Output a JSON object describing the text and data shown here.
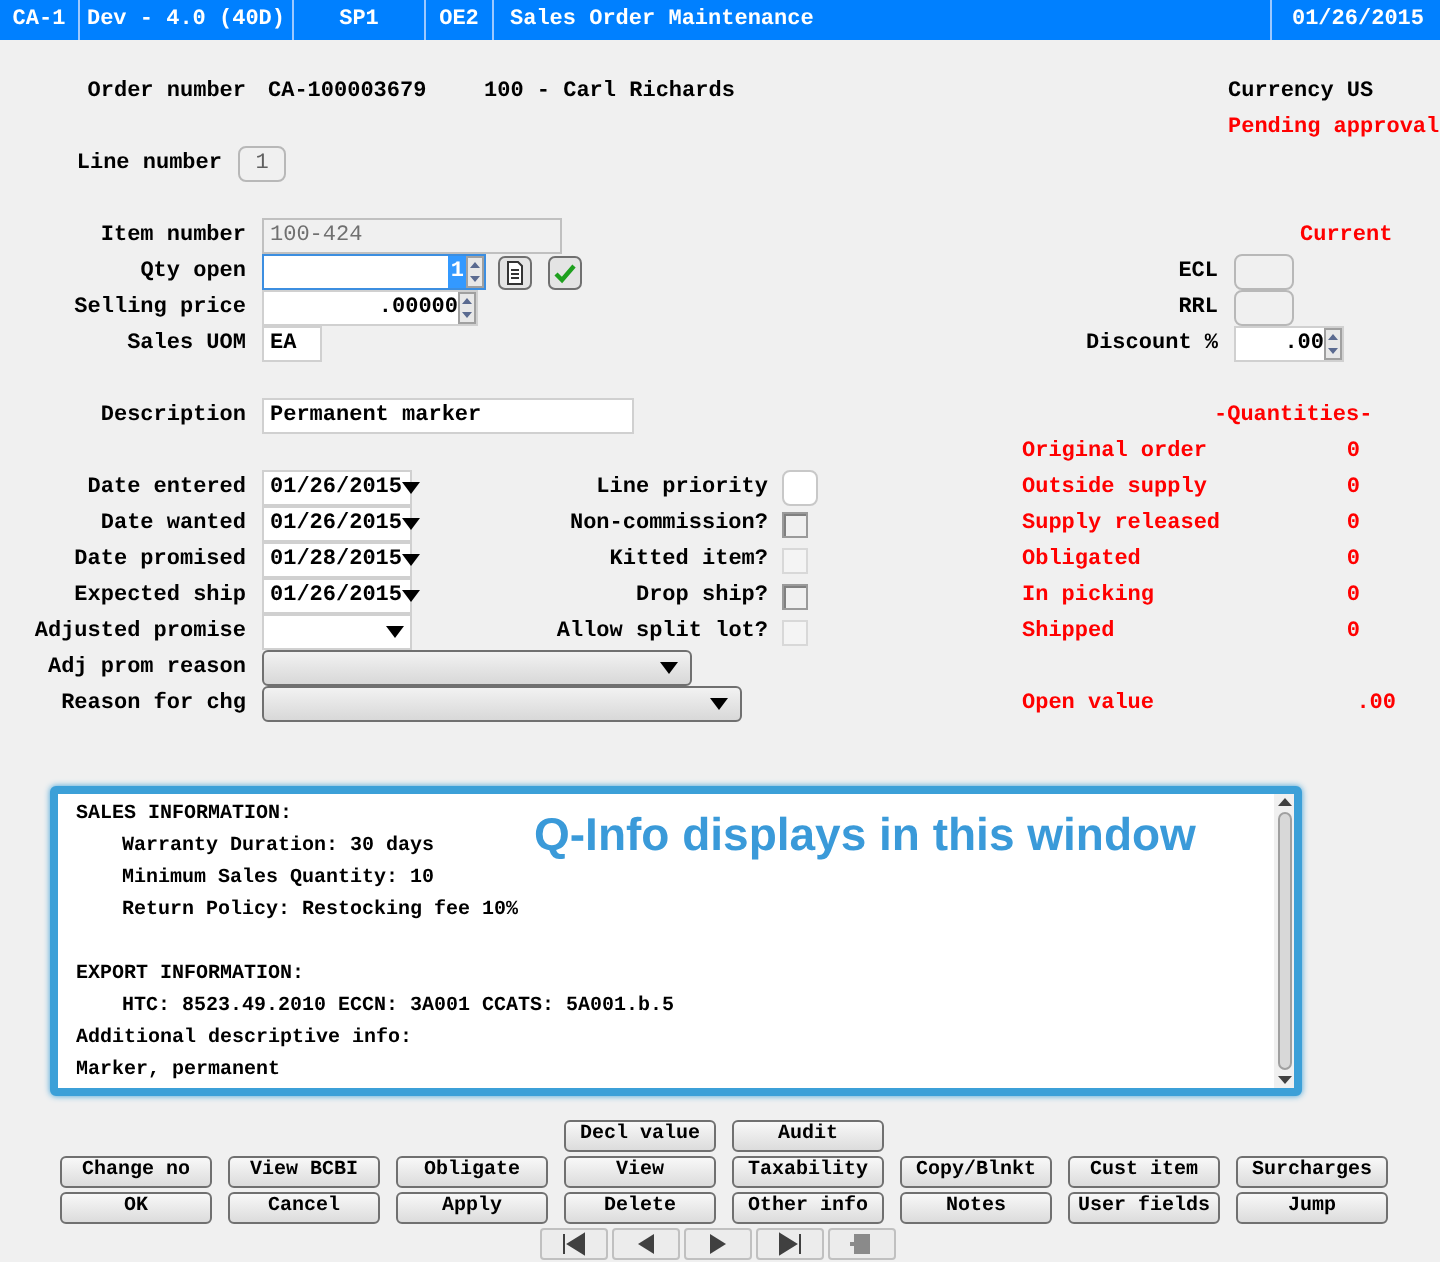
{
  "title_bar": {
    "segments": [
      "CA-1",
      "Dev - 4.0 (40D)",
      "SP1",
      "OE2",
      "Sales Order Maintenance",
      "01/26/2015"
    ]
  },
  "header": {
    "order_label": "Order number",
    "order_number": "CA-100003679",
    "customer": "100 - Carl Richards",
    "currency": "Currency US",
    "status": "Pending approval"
  },
  "line_number": {
    "label": "Line number",
    "value": "1"
  },
  "item_number": {
    "label": "Item number",
    "value": "100-424",
    "disabled": true
  },
  "item_status": "Current",
  "qty_open": {
    "label": "Qty open",
    "value": "1"
  },
  "selling_price": {
    "label": "Selling price",
    "value": ".00000"
  },
  "sales_uom": {
    "label": "Sales UOM",
    "value": "EA"
  },
  "ecl": {
    "label": "ECL"
  },
  "rrl": {
    "label": "RRL"
  },
  "discount": {
    "label": "Discount %",
    "value": ".00"
  },
  "description": {
    "label": "Description",
    "value": "Permanent marker"
  },
  "quantities_title": "-Quantities-",
  "quantities": [
    {
      "label": "Original order",
      "value": "0"
    },
    {
      "label": "Outside supply",
      "value": "0"
    },
    {
      "label": "Supply released",
      "value": "0"
    },
    {
      "label": "Obligated",
      "value": "0"
    },
    {
      "label": "In picking",
      "value": "0"
    },
    {
      "label": "Shipped",
      "value": "0"
    }
  ],
  "dates": [
    {
      "label": "Date entered",
      "value": "01/26/2015"
    },
    {
      "label": "Date wanted",
      "value": "01/26/2015"
    },
    {
      "label": "Date promised",
      "value": "01/28/2015"
    },
    {
      "label": "Expected ship",
      "value": "01/26/2015"
    },
    {
      "label": "Adjusted promise"
    }
  ],
  "options": [
    {
      "kind": "text",
      "label": "Line priority"
    },
    {
      "kind": "checkbox",
      "label": "Non-commission?",
      "checked": false,
      "disabled": false
    },
    {
      "kind": "checkbox",
      "label": "Kitted item?",
      "checked": false,
      "disabled": true
    },
    {
      "kind": "checkbox",
      "label": "Drop ship?",
      "checked": false,
      "disabled": false
    },
    {
      "kind": "checkbox",
      "label": "Allow split lot?",
      "checked": false,
      "disabled": true
    }
  ],
  "adj_prom_reason": {
    "label": "Adj prom reason"
  },
  "reason_for_chg": {
    "label": "Reason for chg"
  },
  "open_value": {
    "label": "Open value",
    "value": ".00"
  },
  "qinfo": {
    "overlay": "Q-Info displays in this window",
    "lines": [
      {
        "text": "SALES INFORMATION:",
        "children": [
          {
            "text": "Warranty Duration: 30 days"
          },
          {
            "text": "Minimum Sales Quantity: 10"
          },
          {
            "text": "Return Policy: Restocking fee 10%"
          }
        ]
      },
      {
        "text": "EXPORT INFORMATION:",
        "children": [
          {
            "text": "HTC: 8523.49.2010  ECCN: 3A001  CCATS: 5A001.b.5"
          }
        ]
      },
      {
        "text": "Additional descriptive info:"
      },
      {
        "text": "Marker, permanent"
      }
    ]
  },
  "top_buttons": [
    "Decl value",
    "Audit"
  ],
  "button_rows": [
    [
      "Change no",
      "View BCBI",
      "Obligate",
      "View",
      "Taxability",
      "Copy/Blnkt",
      "Cust item",
      "Surcharges"
    ],
    [
      "OK",
      "Cancel",
      "Apply",
      "Delete",
      "Other info",
      "Notes",
      "User fields",
      "Jump"
    ]
  ]
}
